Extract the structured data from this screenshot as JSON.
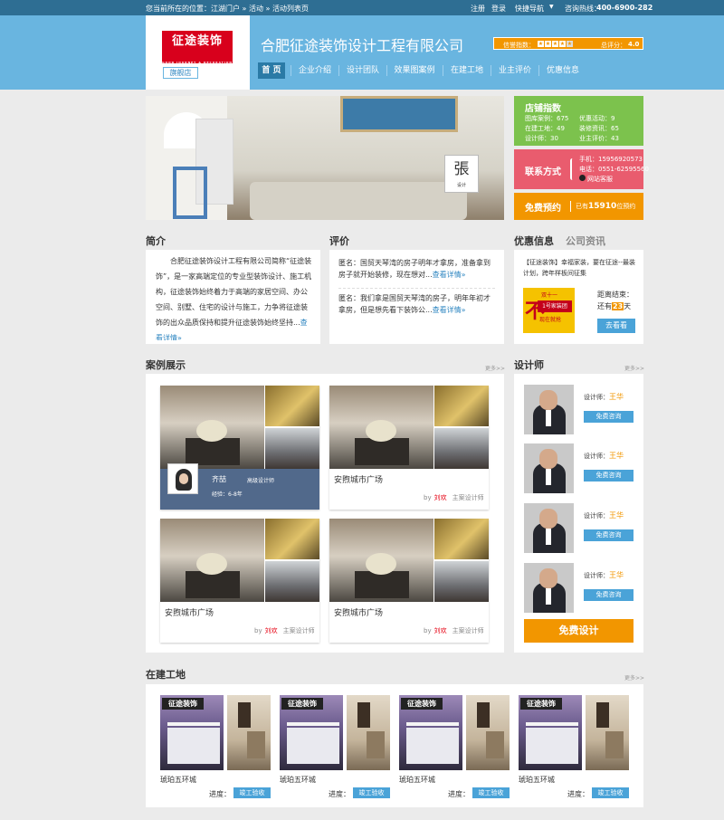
{
  "topbar": {
    "location": "您当前所在的位置：江湖门户 » 活动 » 活动列表页",
    "links": [
      "注册",
      "登录",
      "快捷导航"
    ],
    "hotline_label": "咨询热线：",
    "hotline": "400-6900-282"
  },
  "header": {
    "logo": "征途装饰",
    "logo_sub": "GOOD JOURNEY & DECORATION",
    "flagship": "旗舰店",
    "company": "合肥征途装饰设计工程有限公司",
    "rating_label": "信誉指数：",
    "stars": 4.5,
    "score_label": "总评分：",
    "score": "4.0"
  },
  "nav": [
    "首 页",
    "企业介绍",
    "设计团队",
    "效果图案例",
    "在建工地",
    "业主评价",
    "优惠信息"
  ],
  "hero": {
    "logo_text": "張",
    "logo_sub": "设计"
  },
  "stats": {
    "title": "店铺指数",
    "rows": [
      [
        "图库案例：675",
        "优惠活动：9"
      ],
      [
        "在建工地：49",
        "装修资讯：65"
      ],
      [
        "设计师：30",
        "业主评价：43"
      ]
    ]
  },
  "contact": {
    "title": "联系方式",
    "mobile": "手机：15956920573",
    "phone": "电话：0551-62595560",
    "qq": "网站客服"
  },
  "booking": {
    "title": "免费预约",
    "text_pre": "已有",
    "count": "15910",
    "text_post": "位预约"
  },
  "intro": {
    "title": "简介",
    "text": "合肥征途装饰设计工程有限公司简称“征途装饰”，是一家高端定位的专业型装饰设计、施工机构，征途装饰始终着力于高端的家居空间、办公空间、别墅、住宅的设计与施工，力争将征途装饰的出众品质保持和提升征途装饰始终坚持...",
    "link": "查看详情"
  },
  "reviews": {
    "title": "评价",
    "items": [
      {
        "text": "匿名：国贸天琴湾的房子明年才拿房，准备拿到房子就开始装修，现在想对...",
        "link": "查看详情"
      },
      {
        "text": "匿名：我们拿是国贸天琴湾的房子，明年年初才拿房，但是想先看下装饰公...",
        "link": "查看详情"
      }
    ]
  },
  "promo": {
    "tab1": "优惠信息",
    "tab2": "公司资讯",
    "text": "【征途装饰】幸福家装，要在征途--最装计划，跨年样板间征集",
    "img_big": "不",
    "img_label": "1号家装团",
    "img_sub": "现在就抢",
    "img_top": "双十一",
    "countdown_label": "距离结束：",
    "left": "还有",
    "days": "23",
    "unit": "天",
    "button": "去看看"
  },
  "cases": {
    "title": "案例展示",
    "more": "更多>>",
    "items": [
      {
        "title": "安煦城市广场",
        "by": "by",
        "author": "刘欢",
        "role": "主案设计师"
      },
      {
        "title": "安煦城市广场",
        "by": "by",
        "author": "刘欢",
        "role": "主案设计师"
      },
      {
        "title": "安煦城市广场",
        "by": "by",
        "author": "刘欢",
        "role": "主案设计师"
      },
      {
        "title": "安煦城市广场",
        "by": "by",
        "author": "刘欢",
        "role": "主案设计师"
      }
    ],
    "hover": {
      "name": "齐喆",
      "role": "高级设计师",
      "exp": "经验：6-8年"
    }
  },
  "designers": {
    "title": "设计师",
    "more": "更多>>",
    "label": "设计师：",
    "items": [
      {
        "name": "王华",
        "button": "免费咨询"
      },
      {
        "name": "王华",
        "button": "免费咨询"
      },
      {
        "name": "王华",
        "button": "免费咨询"
      },
      {
        "name": "王华",
        "button": "免费咨询"
      }
    ],
    "free_button": "免费设计"
  },
  "sites": {
    "title": "在建工地",
    "more": "更多>>",
    "items": [
      {
        "name": "琥珀五环城",
        "progress_label": "进度：",
        "status": "竣工验收"
      },
      {
        "name": "琥珀五环城",
        "progress_label": "进度：",
        "status": "竣工验收"
      },
      {
        "name": "琥珀五环城",
        "progress_label": "进度：",
        "status": "竣工验收"
      },
      {
        "name": "琥珀五环城",
        "progress_label": "进度：",
        "status": "竣工验收"
      }
    ]
  },
  "colors": {
    "topbar": "#2e6e93",
    "header": "#69b5e0",
    "green": "#7cc24d",
    "red": "#e95c6e",
    "orange": "#f29600",
    "link": "#2e86c1"
  }
}
